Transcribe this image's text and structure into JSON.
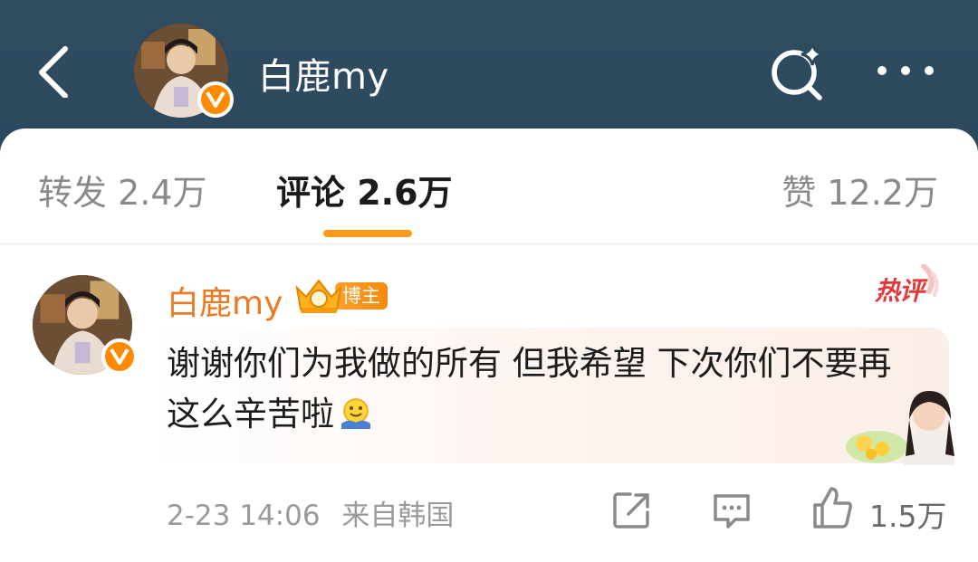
{
  "header": {
    "title": "白鹿my",
    "back_icon": "chevron-left-icon",
    "search_icon": "search-sparkle-icon",
    "more_icon": "more-dots-icon",
    "bg_color": "#2e4a5f"
  },
  "tabs": {
    "repost": "转发 2.4万",
    "comment": "评论 2.6万",
    "like": "赞 12.2万",
    "active": "comment",
    "accent": "#ff9a1a"
  },
  "comment": {
    "author": "白鹿my",
    "badge": "博主",
    "hot_label": "热评",
    "text": "谢谢你们为我做的所有 但我希望 下次你们不要再这么辛苦啦",
    "time": "2-23 14:06",
    "source": "来自韩国",
    "like_count": "1.5万",
    "name_color": "#eb7a23"
  }
}
